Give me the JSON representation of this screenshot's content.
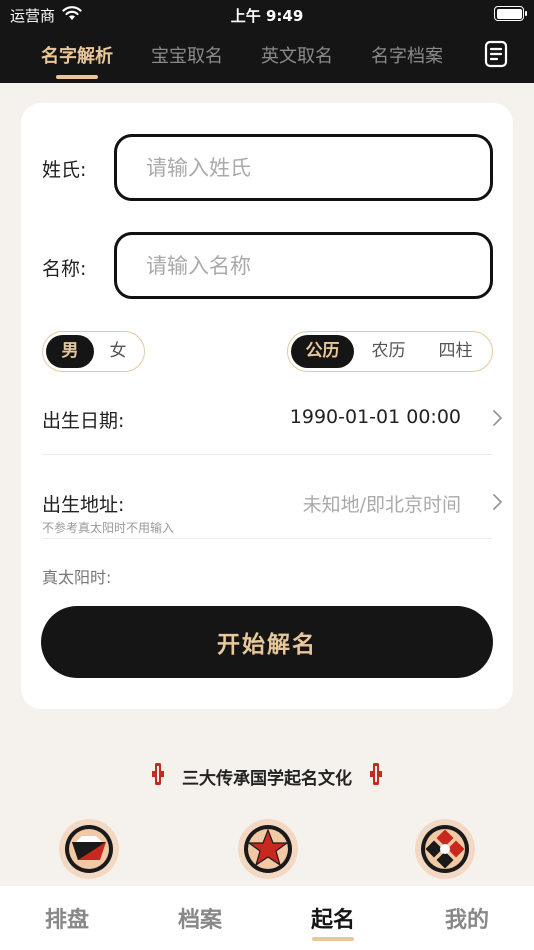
{
  "status_bar": {
    "carrier": "运营商",
    "time": "上午 9:49",
    "battery": 1.0
  },
  "top_nav": {
    "tabs": [
      {
        "label": "名字解析",
        "active": true
      },
      {
        "label": "宝宝取名",
        "active": false
      },
      {
        "label": "英文取名",
        "active": false
      },
      {
        "label": "名字档案",
        "active": false
      }
    ]
  },
  "form": {
    "surname": {
      "label": "姓氏:",
      "placeholder": "请输入姓氏",
      "value": ""
    },
    "given_name": {
      "label": "名称:",
      "placeholder": "请输入名称",
      "value": ""
    },
    "gender": {
      "options": [
        "男",
        "女"
      ],
      "selected": "男"
    },
    "calendar": {
      "options": [
        "公历",
        "农历",
        "四柱"
      ],
      "selected": "公历"
    },
    "birth_date": {
      "label": "出生日期:",
      "value": "1990-01-01 00:00"
    },
    "birth_place": {
      "label": "出生地址:",
      "value": "未知地/即北京时间",
      "hint": "不参考真太阳时不用输入"
    },
    "solar_time": {
      "label": "真太阳时:"
    },
    "submit_label": "开始解名"
  },
  "culture_title": "三大传承国学起名文化",
  "bottom_tabs": [
    {
      "label": "排盘",
      "active": false
    },
    {
      "label": "档案",
      "active": false
    },
    {
      "label": "起名",
      "active": true
    },
    {
      "label": "我的",
      "active": false
    }
  ],
  "colors": {
    "dark": "#151515",
    "gold": "#e8c79a",
    "accent_red": "#c8281e",
    "background": "#f5f2ed"
  }
}
